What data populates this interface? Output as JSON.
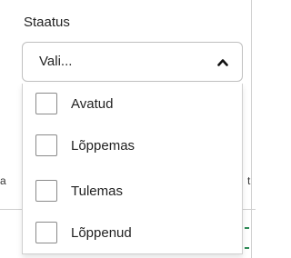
{
  "field": {
    "label": "Staatus",
    "placeholder": "Vali...",
    "expanded": true
  },
  "options": [
    {
      "label": "Avatud",
      "checked": false
    },
    {
      "label": "Lõppemas",
      "checked": false
    },
    {
      "label": "Tulemas",
      "checked": false
    },
    {
      "label": "Lõppenud",
      "checked": false
    }
  ],
  "background": {
    "left_fragment": "a",
    "right_fragment": "t"
  },
  "colors": {
    "border": "#bfbfbf",
    "checkbox_border": "#8a8a8a",
    "text": "#222222",
    "accent_green": "#2e8b57"
  },
  "icons": {
    "dropdown_toggle": "chevron-up-icon"
  }
}
